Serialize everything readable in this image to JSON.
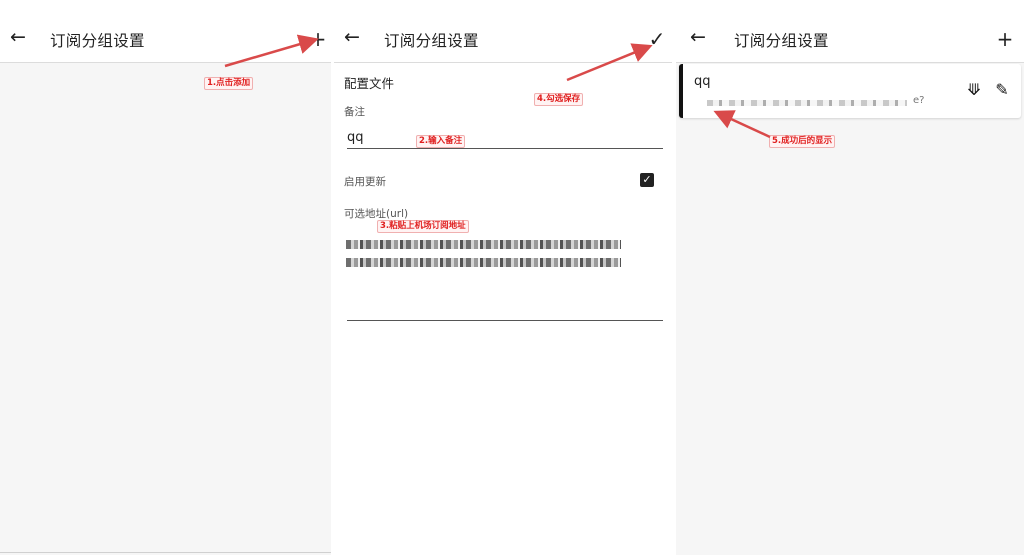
{
  "screens": [
    {
      "appbar": {
        "back_icon": "arrow-left-icon",
        "title": "订阅分组设置",
        "action_icon": "plus-icon"
      },
      "annotation": "1.点击添加"
    },
    {
      "appbar": {
        "back_icon": "arrow-left-icon",
        "title": "订阅分组设置",
        "action_icon": "check-icon"
      },
      "form": {
        "section_header": "配置文件",
        "remark_label": "备注",
        "remark_value": "qq",
        "enable_update_label": "启用更新",
        "enable_update_checked": true,
        "url_label": "可选地址(url)"
      },
      "annotations": {
        "remark": "2.输入备注",
        "url": "3.粘贴上机场订阅地址",
        "save": "4.勾选保存"
      }
    },
    {
      "appbar": {
        "back_icon": "arrow-left-icon",
        "title": "订阅分组设置",
        "action_icon": "plus-icon"
      },
      "card": {
        "name": "qq",
        "url_tail": "e?",
        "share_icon": "share-icon",
        "edit_icon": "pencil-icon"
      },
      "annotation": "5.成功后的显示"
    }
  ],
  "colors": {
    "annotation": "#e02020",
    "arrow": "#d94a4a",
    "card_accent": "#111111"
  }
}
